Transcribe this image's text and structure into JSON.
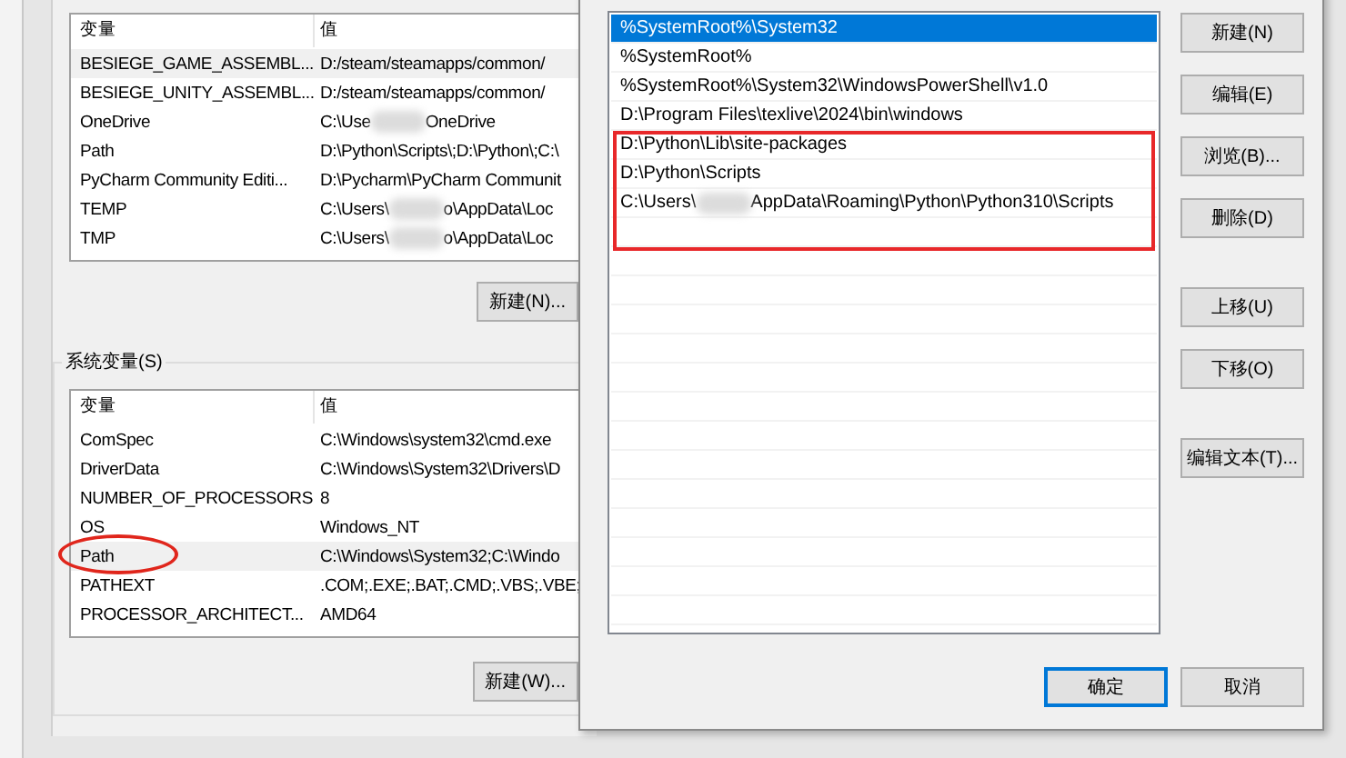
{
  "env_dialog": {
    "user_vars": {
      "columns": [
        "变量",
        "值"
      ],
      "rows": [
        {
          "name": "BESIEGE_GAME_ASSEMBL...",
          "value": [
            "D:/steam/steamapps/common/"
          ],
          "selected": true
        },
        {
          "name": "BESIEGE_UNITY_ASSEMBL...",
          "value": [
            "D:/steam/steamapps/common/"
          ],
          "selected": false
        },
        {
          "name": "OneDrive",
          "value": [
            "C:\\Use",
            "OneDrive"
          ],
          "selected": false
        },
        {
          "name": "Path",
          "value": [
            "D:\\Python\\Scripts\\;D:\\Python\\;C:\\"
          ],
          "selected": false
        },
        {
          "name": "PyCharm Community Editi...",
          "value": [
            "D:\\Pycharm\\PyCharm Communit"
          ],
          "selected": false
        },
        {
          "name": "TEMP",
          "value": [
            "C:\\Users\\",
            "o\\AppData\\Loc"
          ],
          "selected": false
        },
        {
          "name": "TMP",
          "value": [
            "C:\\Users\\",
            "o\\AppData\\Loc"
          ],
          "selected": false
        }
      ],
      "button": "新建(N)..."
    },
    "system_vars": {
      "title": "系统变量(S)",
      "columns": [
        "变量",
        "值"
      ],
      "rows": [
        {
          "name": "ComSpec",
          "value": [
            "C:\\Windows\\system32\\cmd.exe"
          ],
          "selected": false,
          "circled": false
        },
        {
          "name": "DriverData",
          "value": [
            "C:\\Windows\\System32\\Drivers\\D"
          ],
          "selected": false,
          "circled": false
        },
        {
          "name": "NUMBER_OF_PROCESSORS",
          "value": [
            "8"
          ],
          "selected": false,
          "circled": false
        },
        {
          "name": "OS",
          "value": [
            "Windows_NT"
          ],
          "selected": false,
          "circled": false
        },
        {
          "name": "Path",
          "value": [
            "C:\\Windows\\System32;C:\\Windo"
          ],
          "selected": true,
          "circled": true
        },
        {
          "name": "PATHEXT",
          "value": [
            ".COM;.EXE;.BAT;.CMD;.VBS;.VBE;"
          ],
          "selected": false,
          "circled": false
        },
        {
          "name": "PROCESSOR_ARCHITECT...",
          "value": [
            "AMD64"
          ],
          "selected": false,
          "circled": false
        }
      ],
      "button": "新建(W)..."
    }
  },
  "path_dialog": {
    "entries": [
      {
        "value": [
          "%SystemRoot%\\System32"
        ],
        "selected": true,
        "boxed": false
      },
      {
        "value": [
          "%SystemRoot%"
        ],
        "selected": false,
        "boxed": false
      },
      {
        "value": [
          "%SystemRoot%\\System32\\WindowsPowerShell\\v1.0"
        ],
        "selected": false,
        "boxed": false
      },
      {
        "value": [
          "D:\\Program Files\\texlive\\2024\\bin\\windows"
        ],
        "selected": false,
        "boxed": false
      },
      {
        "value": [
          "D:\\Python\\Lib\\site-packages"
        ],
        "selected": false,
        "boxed": true
      },
      {
        "value": [
          "D:\\Python\\Scripts"
        ],
        "selected": false,
        "boxed": true
      },
      {
        "value": [
          "C:\\Users\\",
          "AppData\\Roaming\\Python\\Python310\\Scripts"
        ],
        "selected": false,
        "boxed": true
      }
    ],
    "side_buttons": [
      [
        "新建(N)",
        "编辑(E)",
        "浏览(B)...",
        "删除(D)"
      ],
      [
        "上移(U)",
        "下移(O)"
      ],
      [
        "编辑文本(T)..."
      ]
    ],
    "ok_button": "确定",
    "cancel_button": "取消"
  }
}
